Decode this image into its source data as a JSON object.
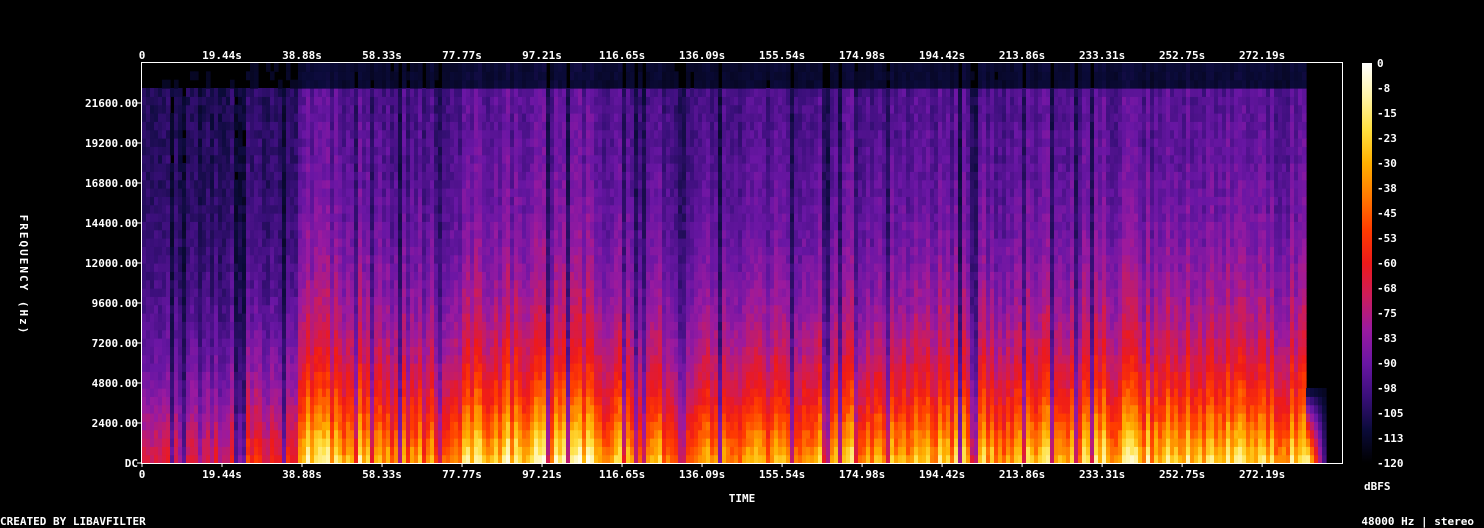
{
  "chart_data": {
    "type": "heatmap",
    "title": "",
    "xlabel": "TIME",
    "ylabel": "FREQUENCY (Hz)",
    "x_ticks": [
      "0",
      "19.44s",
      "38.88s",
      "58.33s",
      "77.77s",
      "97.21s",
      "116.65s",
      "136.09s",
      "155.54s",
      "174.98s",
      "194.42s",
      "213.86s",
      "233.31s",
      "252.75s",
      "272.19s"
    ],
    "x_tick_values": [
      0,
      19.44,
      38.88,
      58.33,
      77.77,
      97.21,
      116.65,
      136.09,
      155.54,
      174.98,
      194.42,
      213.86,
      233.31,
      252.75,
      272.19
    ],
    "xlim": [
      0,
      291.6
    ],
    "audio_end_seconds": 283,
    "y_ticks": [
      "DC",
      "2400.00",
      "4800.00",
      "7200.00",
      "9600.00",
      "12000.00",
      "14400.00",
      "16800.00",
      "19200.00",
      "21600.00"
    ],
    "y_tick_values": [
      0,
      2400,
      4800,
      7200,
      9600,
      12000,
      14400,
      16800,
      19200,
      21600
    ],
    "ylim": [
      0,
      24000
    ],
    "colorbar": {
      "label": "dBFS",
      "ticks": [
        "0",
        "-8",
        "-15",
        "-23",
        "-30",
        "-38",
        "-45",
        "-53",
        "-60",
        "-68",
        "-75",
        "-83",
        "-90",
        "-98",
        "-105",
        "-113",
        "-120"
      ],
      "range": [
        -120,
        0
      ],
      "colors": [
        "#000000",
        "#0b0b3a",
        "#3a0f7a",
        "#6a16a4",
        "#9a1aa0",
        "#cc1c5c",
        "#ee1a1a",
        "#ff3c00",
        "#ff7a00",
        "#ffb000",
        "#ffe040",
        "#fff4a8",
        "#ffffff"
      ]
    },
    "bright_sections": [
      {
        "start": 0,
        "end": 20,
        "level": 0.45
      },
      {
        "start": 20,
        "end": 38,
        "level": 0.55
      },
      {
        "start": 38,
        "end": 58,
        "level": 0.85
      },
      {
        "start": 58,
        "end": 78,
        "level": 0.72
      },
      {
        "start": 78,
        "end": 112,
        "level": 0.88
      },
      {
        "start": 112,
        "end": 125,
        "level": 0.8
      },
      {
        "start": 125,
        "end": 155,
        "level": 0.75
      },
      {
        "start": 155,
        "end": 215,
        "level": 0.82
      },
      {
        "start": 215,
        "end": 283,
        "level": 0.85
      }
    ]
  },
  "footer": {
    "left": "CREATED BY LIBAVFILTER",
    "right": "48000 Hz | stereo"
  }
}
